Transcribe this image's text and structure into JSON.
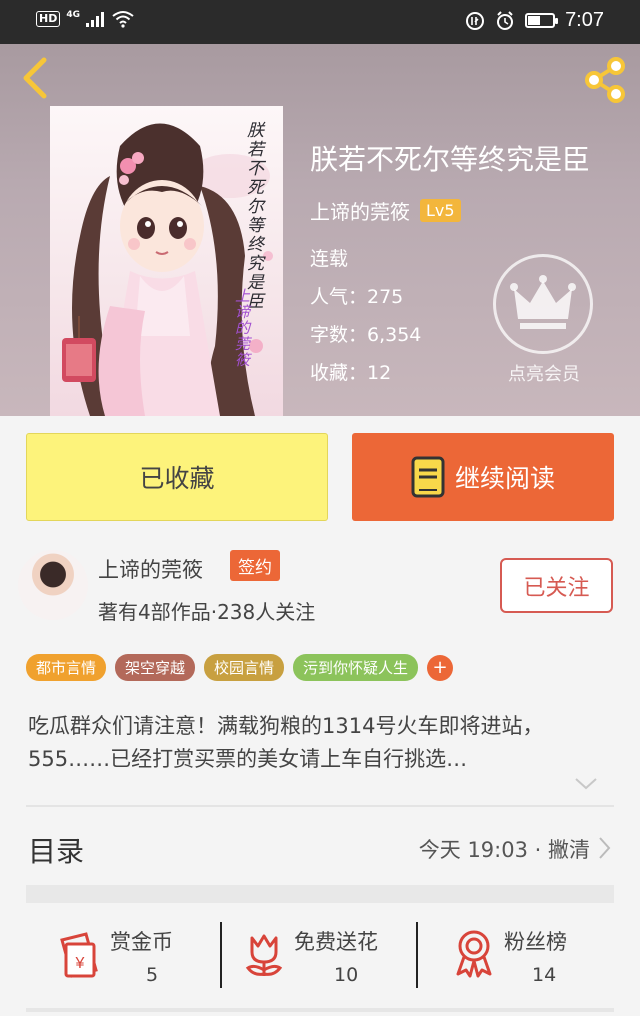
{
  "status_bar": {
    "hd": "HD",
    "network": "4G",
    "time": "7:07"
  },
  "book": {
    "title": "朕若不死尔等终究是臣",
    "author": "上谛的莞筱",
    "level": "Lv5",
    "status": "连载",
    "popularity": "人气：275",
    "word_count": "字数：6,354",
    "favorites": "收藏：12",
    "cover_title": "朕若不死尔等终究是臣",
    "cover_author": "上谛的莞筱"
  },
  "vip": {
    "label": "点亮会员"
  },
  "actions": {
    "collect_label": "已收藏",
    "read_label": "继续阅读"
  },
  "author_card": {
    "name": "上谛的莞筱",
    "sign_badge": "签约",
    "stats": "著有4部作品·238人关注",
    "follow_label": "已关注"
  },
  "tags": [
    {
      "label": "都市言情",
      "color": "#f0a12e"
    },
    {
      "label": "架空穿越",
      "color": "#b3695a"
    },
    {
      "label": "校园言情",
      "color": "#c8a040"
    },
    {
      "label": "污到你怀疑人生",
      "color": "#8cc35b"
    }
  ],
  "tag_more": "+",
  "synopsis": "吃瓜群众们请注意！满载狗粮的1314号火车即将进站，555……已经打赏买票的美女请上车自行挑选…",
  "catalog": {
    "title": "目录",
    "update": "今天 19:03 · 撇清"
  },
  "stats": [
    {
      "label": "赏金币",
      "value": "5",
      "icon": "red-envelope-icon"
    },
    {
      "label": "免费送花",
      "value": "10",
      "icon": "flower-icon"
    },
    {
      "label": "粉丝榜",
      "value": "14",
      "icon": "medal-icon"
    }
  ],
  "colors": {
    "accent": "#ec6737",
    "collect_bg": "#fdf37b",
    "icon_red": "#d8443a",
    "lv_badge": "#f3b63c"
  }
}
